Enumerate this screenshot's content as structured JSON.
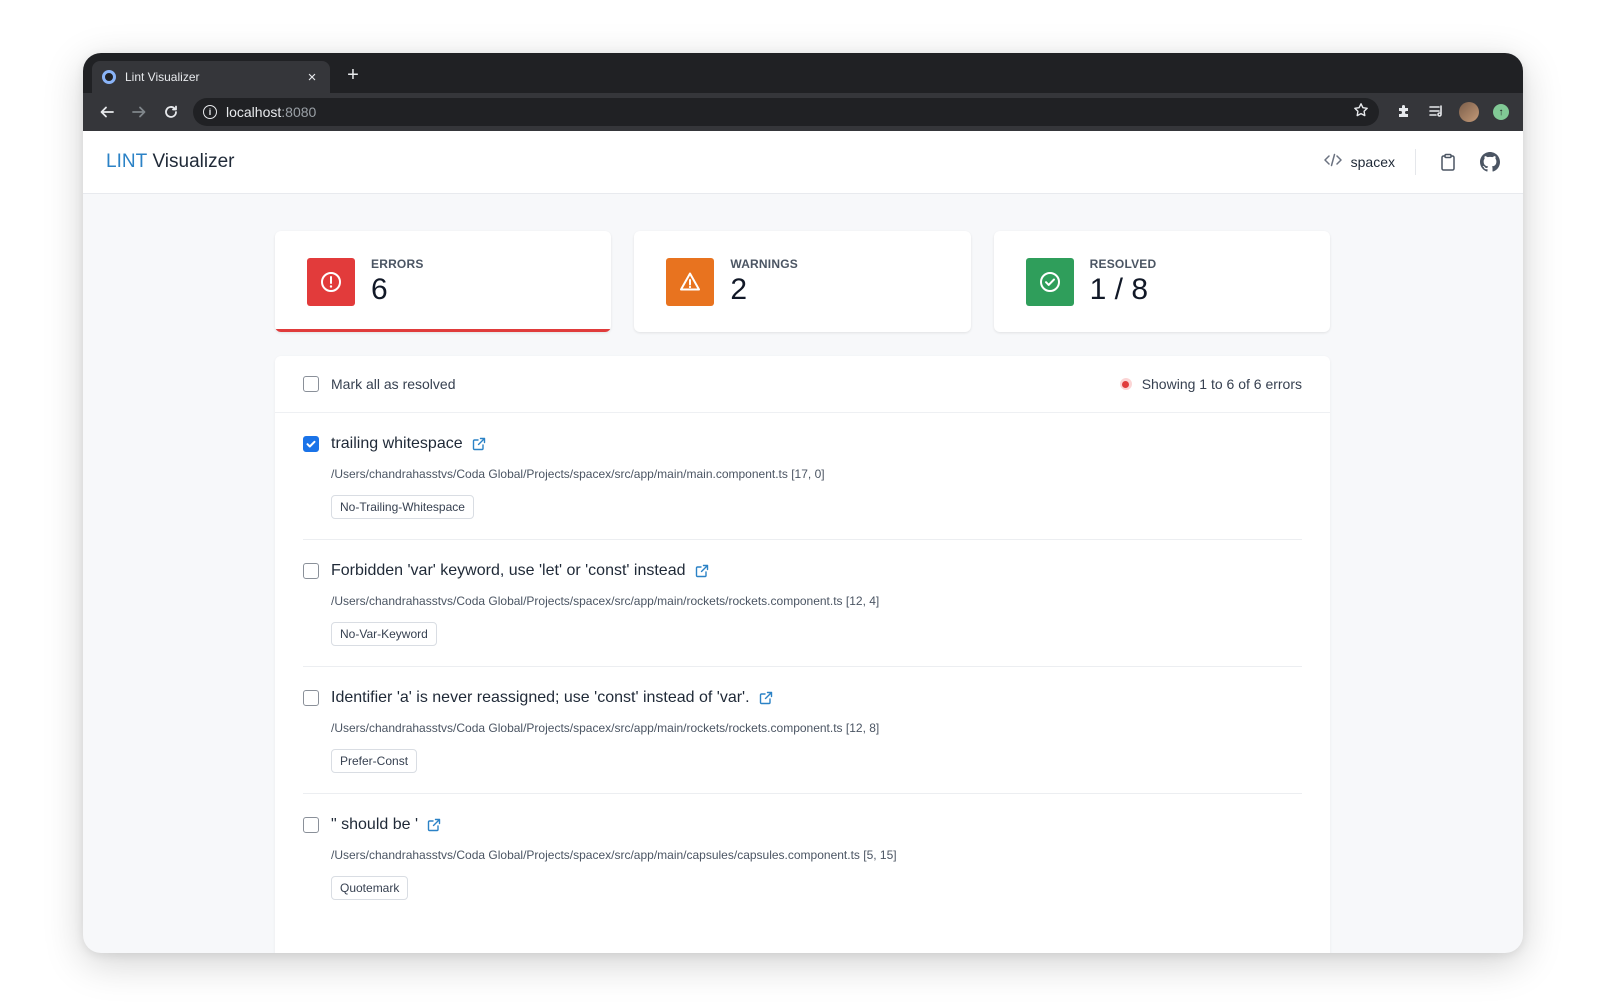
{
  "browser": {
    "tab_title": "Lint Visualizer",
    "tab_close": "×",
    "new_tab": "+",
    "url_host": "localhost",
    "url_port": ":8080"
  },
  "header": {
    "brand_prefix": "LINT",
    "brand_suffix": " Visualizer",
    "project_name": "spacex"
  },
  "stats": [
    {
      "label": "ERRORS",
      "value": "6",
      "color": "#e23b3b",
      "icon": "error-circle-icon",
      "active": true
    },
    {
      "label": "WARNINGS",
      "value": "2",
      "color": "#e8731f",
      "icon": "warning-triangle-icon",
      "active": false
    },
    {
      "label": "RESOLVED",
      "value": "1 / 8",
      "color": "#2f9e5b",
      "icon": "check-circle-icon",
      "active": false
    }
  ],
  "list": {
    "mark_all_label": "Mark all as resolved",
    "showing_text": "Showing 1 to 6 of 6 errors",
    "items": [
      {
        "checked": true,
        "title": "trailing whitespace",
        "path": "/Users/chandrahasstvs/Coda Global/Projects/spacex/src/app/main/main.component.ts [17, 0]",
        "tag": "No-Trailing-Whitespace"
      },
      {
        "checked": false,
        "title": "Forbidden 'var' keyword, use 'let' or 'const' instead",
        "path": "/Users/chandrahasstvs/Coda Global/Projects/spacex/src/app/main/rockets/rockets.component.ts [12, 4]",
        "tag": "No-Var-Keyword"
      },
      {
        "checked": false,
        "title": "Identifier 'a' is never reassigned; use 'const' instead of 'var'.",
        "path": "/Users/chandrahasstvs/Coda Global/Projects/spacex/src/app/main/rockets/rockets.component.ts [12, 8]",
        "tag": "Prefer-Const"
      },
      {
        "checked": false,
        "title": "\" should be '",
        "path": "/Users/chandrahasstvs/Coda Global/Projects/spacex/src/app/main/capsules/capsules.component.ts [5, 15]",
        "tag": "Quotemark"
      }
    ]
  },
  "colors": {
    "accent": "#2b82c6",
    "error": "#e23b3b",
    "warning": "#e8731f",
    "success": "#2f9e5b",
    "checkbox": "#1a73e8"
  }
}
